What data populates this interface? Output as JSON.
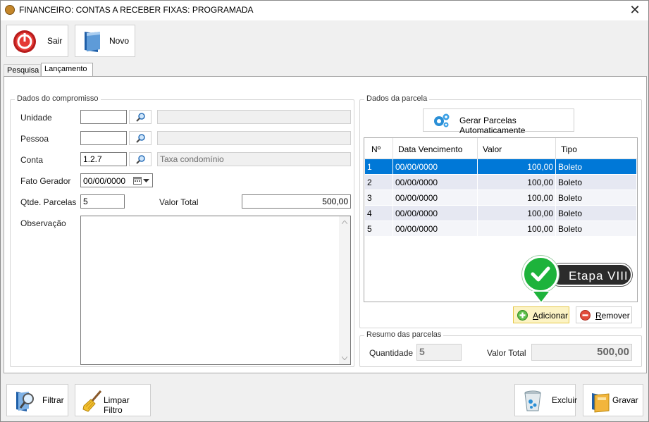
{
  "window": {
    "title": "FINANCEIRO: CONTAS A RECEBER FIXAS: PROGRAMADA"
  },
  "toolbar": {
    "sair_label": "Sair",
    "novo_label": "Novo"
  },
  "tabs": [
    {
      "label": "Pesquisa"
    },
    {
      "label": "Lançamento"
    }
  ],
  "compromisso": {
    "title": "Dados do compromisso",
    "unidade_label": "Unidade",
    "unidade_value": "",
    "unidade_desc": "",
    "pessoa_label": "Pessoa",
    "pessoa_value": "",
    "pessoa_desc": "",
    "conta_label": "Conta",
    "conta_value": "1.2.7",
    "conta_desc": "Taxa condomínio",
    "fato_label": "Fato Gerador",
    "fato_value": "00/00/0000",
    "qtde_label": "Qtde. Parcelas",
    "qtde_value": "5",
    "valor_total_label": "Valor Total",
    "valor_total_value": "500,00",
    "observacao_label": "Observação",
    "observacao_value": ""
  },
  "parcela": {
    "title": "Dados da parcela",
    "gerar_label": "Gerar Parcelas Automaticamente",
    "columns": [
      "Nº",
      "Data Vencimento",
      "Valor",
      "Tipo"
    ],
    "rows": [
      {
        "n": "1",
        "data": "00/00/0000",
        "valor": "100,00",
        "tipo": "Boleto"
      },
      {
        "n": "2",
        "data": "00/00/0000",
        "valor": "100,00",
        "tipo": "Boleto"
      },
      {
        "n": "3",
        "data": "00/00/0000",
        "valor": "100,00",
        "tipo": "Boleto"
      },
      {
        "n": "4",
        "data": "00/00/0000",
        "valor": "100,00",
        "tipo": "Boleto"
      },
      {
        "n": "5",
        "data": "00/00/0000",
        "valor": "100,00",
        "tipo": "Boleto"
      }
    ],
    "selected_row": "1",
    "add_label_accel": "A",
    "add_label_rest": "dicionar",
    "remove_label_accel": "R",
    "remove_label_rest": "emover"
  },
  "step_badge": {
    "label": "Etapa VIII",
    "color": "#1db33b"
  },
  "resumo": {
    "title": "Resumo das parcelas",
    "quantidade_label": "Quantidade",
    "quantidade_value": "5",
    "valor_total_label": "Valor Total",
    "valor_total_value": "500,00"
  },
  "bottom_toolbar": {
    "filtrar_label": "Filtrar",
    "limpar_label": "Limpar Filtro",
    "excluir_label": "Excluir",
    "gravar_label": "Gravar"
  },
  "colors": {
    "selection": "#0078d7",
    "highlight_button": "#fcf3c4"
  }
}
